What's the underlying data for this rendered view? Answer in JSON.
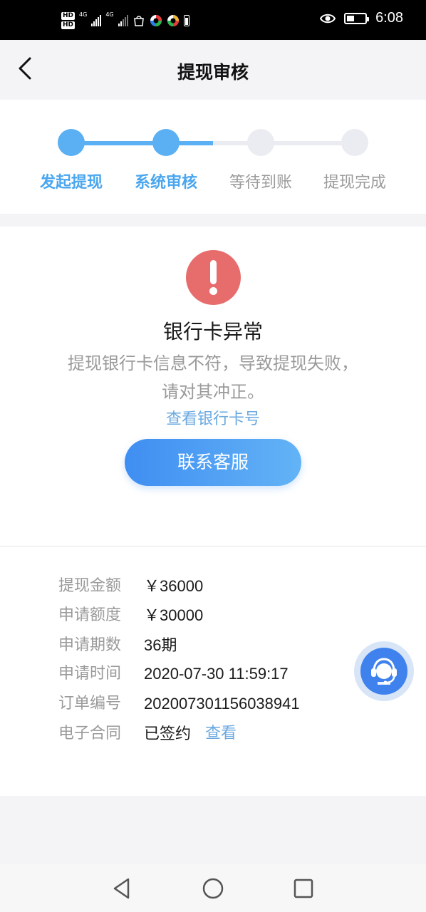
{
  "status_bar": {
    "hd1": "HD",
    "hd2": "HD",
    "net1": "4G",
    "net2": "4G",
    "time": "6:08"
  },
  "header": {
    "title": "提现审核"
  },
  "stepper": {
    "steps": [
      {
        "label": "发起提现",
        "state": "completed"
      },
      {
        "label": "系统审核",
        "state": "completed"
      },
      {
        "label": "等待到账",
        "state": "pending"
      },
      {
        "label": "提现完成",
        "state": "pending"
      }
    ],
    "active_color": "#5ab0f3",
    "inactive_color": "#ebecf1"
  },
  "status": {
    "icon": "exclamation-icon",
    "title": "银行卡异常",
    "description": "提现银行卡信息不符，导致提现失败，请对其冲正。",
    "view_link": "查看银行卡号",
    "contact_button": "联系客服",
    "alert_color": "#e76d6d"
  },
  "details": {
    "rows": [
      {
        "label": "提现金额",
        "value": "￥36000"
      },
      {
        "label": "申请额度",
        "value": "￥30000"
      },
      {
        "label": "申请期数",
        "value": "36期"
      },
      {
        "label": "申请时间",
        "value": "2020-07-30 11:59:17"
      },
      {
        "label": "订单编号",
        "value": "2020073011560389​41"
      },
      {
        "label": "电子合同",
        "value": "已签约",
        "link": "查看"
      }
    ]
  },
  "support_fab": {
    "icon": "customer-service-icon"
  },
  "nav": {
    "back": "back-triangle-icon",
    "home": "home-circle-icon",
    "recent": "recent-square-icon"
  }
}
